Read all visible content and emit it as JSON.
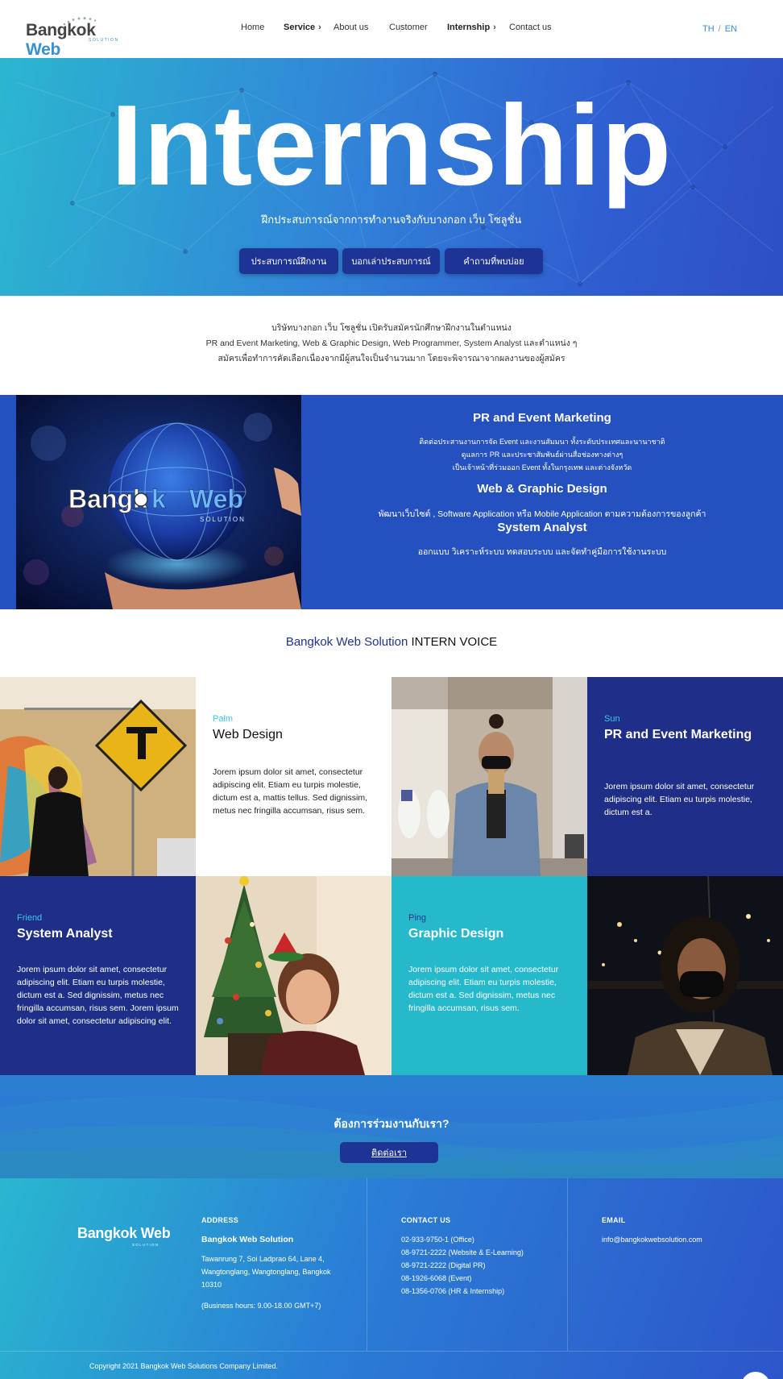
{
  "brand": {
    "logo_main": "Bangkok",
    "logo_web": "Web",
    "logo_sub": "SOLUTION"
  },
  "nav": {
    "items": [
      {
        "label": "Home",
        "chevron": false
      },
      {
        "label": "Service",
        "chevron": true
      },
      {
        "label": "About us",
        "chevron": false
      },
      {
        "label": "Customer",
        "chevron": false
      },
      {
        "label": "Internship",
        "chevron": true
      },
      {
        "label": "Contact us",
        "chevron": false
      }
    ],
    "lang": {
      "th": "TH",
      "sep": "/",
      "en": "EN"
    }
  },
  "hero": {
    "title": "Internship",
    "subtitle": "ฝึกประสบการณ์จากการทำงานจริงกับบางกอก เว็บ โซลูชั่น",
    "buttons": [
      "ประสบการณ์ฝึกงาน",
      "บอกเล่าประสบการณ์",
      "คำถามที่พบบ่อย"
    ]
  },
  "intro": {
    "lines": [
      "บริษัทบางกอก เว็บ โซลูชั่น เปิดรับสมัครนักศึกษาฝึกงานในตำแหน่ง",
      "PR and Event Marketing, Web & Graphic Design, Web Programmer, System Analyst และตำแหน่ง ๆ",
      "สมัครเพื่อทำการคัดเลือกเนื่องจากมีผู้สนใจเป็นจำนวนมาก โดยจะพิจารณาจากผลงานของผู้สมัคร"
    ]
  },
  "positions": {
    "image_logo": "Bangkok Web",
    "image_sub": "SOLUTION",
    "pr": {
      "title": "PR and Event Marketing",
      "lines": [
        "ติดต่อประสานงานการจัด Event และงานสัมมนา ทั้งระดับประเทศและนานาชาติ",
        "ดูแลการ PR และประชาสัมพันธ์ผ่านสื่อช่องทางต่างๆ",
        "เป็นเจ้าหน้าที่ร่วมออก Event ทั้งในกรุงเทพ และต่างจังหวัด"
      ]
    },
    "web": {
      "title": "Web & Graphic Design",
      "text": "พัฒนาเว็บไซต์ , Software Application หรือ Mobile Application ตามความต้องการของลูกค้า"
    },
    "sa": {
      "title": "System Analyst",
      "text": "ออกแบบ วิเคราะห์ระบบ ทดสอบระบบ และจัดทำคู่มือการใช้งานระบบ"
    }
  },
  "voice": {
    "title_brand": "Bangkok Web Solution",
    "title_rest": " INTERN VOICE",
    "cards": [
      {
        "name": "Palm",
        "role": "Web Design",
        "text": "Jorem ipsum dolor sit amet, consectetur adipiscing elit. Etiam eu turpis molestie, dictum est a, mattis tellus. Sed dignissim, metus nec fringilla accumsan, risus sem."
      },
      {
        "name": "Sun",
        "role": "PR and Event Marketing",
        "text": "Jorem ipsum dolor sit amet, consectetur adipiscing elit. Etiam eu turpis molestie, dictum est a."
      },
      {
        "name": "Friend",
        "role": "System Analyst",
        "text": "Jorem ipsum dolor sit amet, consectetur adipiscing elit. Etiam eu turpis molestie, dictum est a. Sed dignissim, metus nec fringilla accumsan, risus sem. Jorem ipsum dolor sit amet, consectetur adipiscing elit."
      },
      {
        "name": "Ping",
        "role": "Graphic Design",
        "text": "Jorem ipsum dolor sit amet, consectetur adipiscing elit. Etiam eu turpis molestie, dictum est a. Sed dignissim, metus nec fringilla accumsan, risus sem."
      }
    ]
  },
  "cta": {
    "title": "ต้องการร่วมงานกับเรา?",
    "button": "ติดต่อเรา"
  },
  "footer": {
    "address": {
      "heading": "ADDRESS",
      "company": "Bangkok Web Solution",
      "line1": "Tawanrung 7, Soi Ladprao 64, Lane 4,",
      "line2": "Wangtonglang, Wangtonglang, Bangkok",
      "line3": "10310",
      "hours": "(Business hours: 9.00-18.00 GMT+7)"
    },
    "contact": {
      "heading": "CONTACT US",
      "phones": [
        "02-933-9750-1 (Office)",
        "08-9721-2222 (Website & E-Learning)",
        "08-9721-2222 (Digital PR)",
        "08-1926-6068 (Event)",
        "08-1356-0706 (HR & Internship)"
      ]
    },
    "email": {
      "heading": "EMAIL",
      "value": "info@bangkokwebsolution.com"
    },
    "copyright": "Copyright 2021 Bangkok Web Solutions Company Limited."
  },
  "colors": {
    "navy": "#1e3494",
    "royal_blue": "#2450c0",
    "dark_blue": "#1f2f88",
    "teal": "#25b9cb",
    "accent_cyan": "#3cc6e8"
  }
}
